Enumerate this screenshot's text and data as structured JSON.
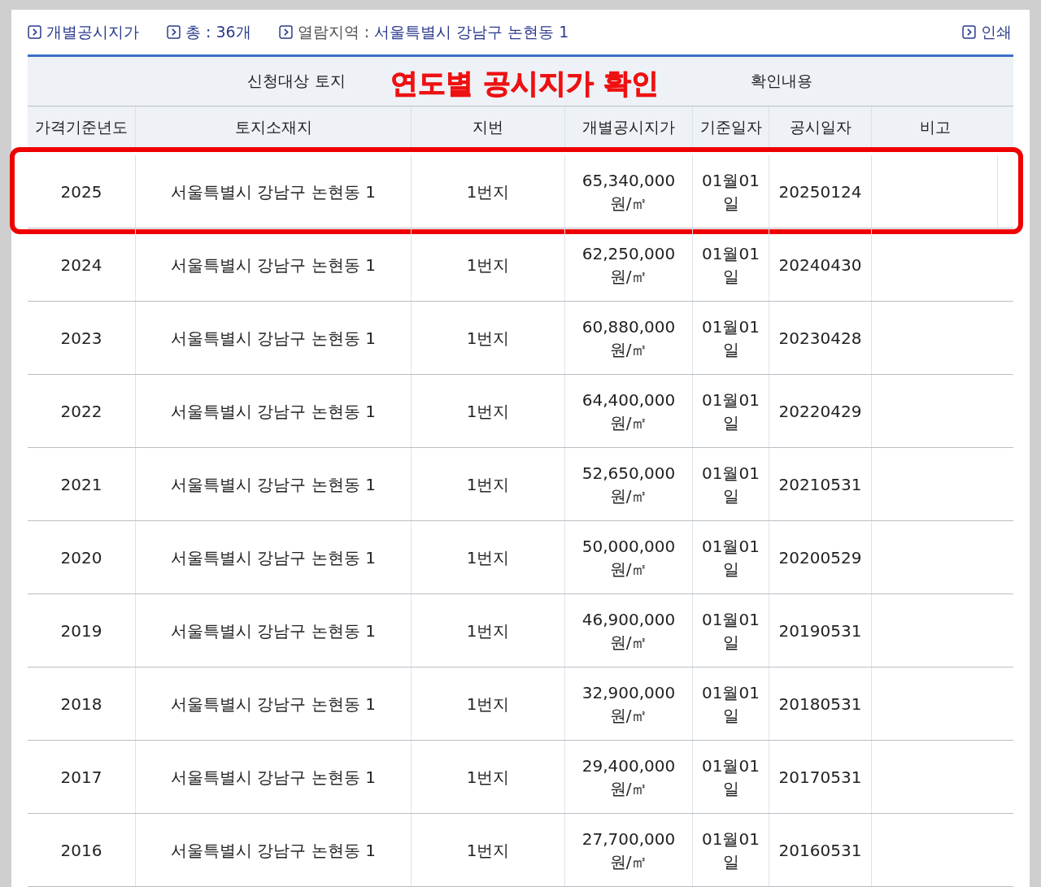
{
  "top_bar": {
    "items": [
      {
        "label": "개별공시지가"
      },
      {
        "label": "총 : 36개"
      },
      {
        "label": "열람지역 : ",
        "value": "서울특별시 강남구 논현동 1"
      }
    ],
    "print_button": "인쇄"
  },
  "annotation": "연도별 공시지가 확인",
  "table": {
    "group_headers": [
      "신청대상 토지",
      "확인내용"
    ],
    "columns": [
      "가격기준년도",
      "토지소재지",
      "지번",
      "개별공시지가",
      "기준일자",
      "공시일자",
      "비고"
    ],
    "rows": [
      {
        "year": "2025",
        "address": "서울특별시 강남구 논현동 1",
        "lot": "1번지",
        "price": "65,340,000 원/㎡",
        "base_date": "01월01일",
        "announce_date": "20250124",
        "highlighted": true
      },
      {
        "year": "2024",
        "address": "서울특별시 강남구 논현동 1",
        "lot": "1번지",
        "price": "62,250,000 원/㎡",
        "base_date": "01월01일",
        "announce_date": "20240430",
        "highlighted": false
      },
      {
        "year": "2023",
        "address": "서울특별시 강남구 논현동 1",
        "lot": "1번지",
        "price": "60,880,000 원/㎡",
        "base_date": "01월01일",
        "announce_date": "20230428",
        "highlighted": false
      },
      {
        "year": "2022",
        "address": "서울특별시 강남구 논현동 1",
        "lot": "1번지",
        "price": "64,400,000 원/㎡",
        "base_date": "01월01일",
        "announce_date": "20220429",
        "highlighted": false
      },
      {
        "year": "2021",
        "address": "서울특별시 강남구 논현동 1",
        "lot": "1번지",
        "price": "52,650,000 원/㎡",
        "base_date": "01월01일",
        "announce_date": "20210531",
        "highlighted": false
      },
      {
        "year": "2020",
        "address": "서울특별시 강남구 논현동 1",
        "lot": "1번지",
        "price": "50,000,000 원/㎡",
        "base_date": "01월01일",
        "announce_date": "20200529",
        "highlighted": false
      },
      {
        "year": "2019",
        "address": "서울특별시 강남구 논현동 1",
        "lot": "1번지",
        "price": "46,900,000 원/㎡",
        "base_date": "01월01일",
        "announce_date": "20190531",
        "highlighted": false
      },
      {
        "year": "2018",
        "address": "서울특별시 강남구 논현동 1",
        "lot": "1번지",
        "price": "32,900,000 원/㎡",
        "base_date": "01월01일",
        "announce_date": "20180531",
        "highlighted": false
      },
      {
        "year": "2017",
        "address": "서울특별시 강남구 논현동 1",
        "lot": "1번지",
        "price": "29,400,000 원/㎡",
        "base_date": "01월01일",
        "announce_date": "20170531",
        "highlighted": false
      },
      {
        "year": "2016",
        "address": "서울특별시 강남구 논현동 1",
        "lot": "1번지",
        "price": "27,700,000 원/㎡",
        "base_date": "01월01일",
        "announce_date": "20160531",
        "highlighted": false
      }
    ]
  }
}
